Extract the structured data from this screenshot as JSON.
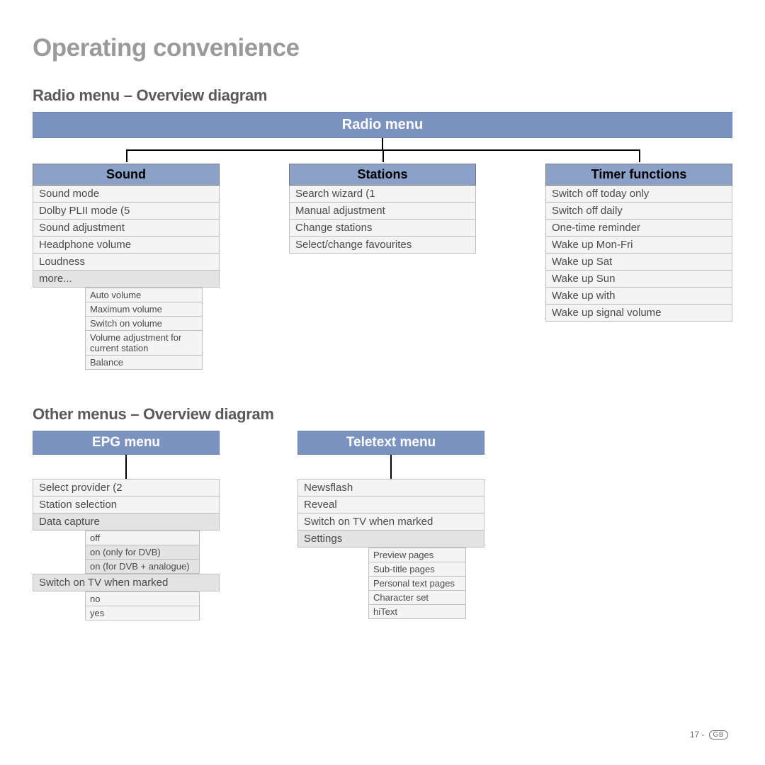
{
  "title": "Operating convenience",
  "section1": "Radio menu – Overview diagram",
  "radio_menu": "Radio menu",
  "sound": {
    "header": "Sound",
    "items": [
      "Sound mode",
      "Dolby PLII mode (5",
      "Sound adjustment",
      "Headphone volume",
      "Loudness"
    ],
    "more": "more...",
    "sub": [
      "Auto volume",
      "Maximum volume",
      "Switch on volume",
      "Volume adjustment for current station",
      "Balance"
    ]
  },
  "stations": {
    "header": "Stations",
    "items": [
      "Search wizard (1",
      "Manual adjustment",
      "Change stations",
      "Select/change favourites"
    ]
  },
  "timer": {
    "header": "Timer functions",
    "items": [
      "Switch off today only",
      "Switch off daily",
      "One-time reminder",
      "Wake up Mon-Fri",
      "Wake up Sat",
      "Wake up Sun",
      "Wake up with",
      "Wake up signal volume"
    ]
  },
  "section2": "Other menus – Overview diagram",
  "epg": {
    "header": "EPG menu",
    "items": [
      "Select provider (2",
      "Station selection"
    ],
    "expand1": "Data capture",
    "sub1": [
      "off",
      "on (only for DVB)",
      "on (for DVB + analogue)"
    ],
    "expand2": "Switch on TV when marked",
    "sub2": [
      "no",
      "yes"
    ]
  },
  "tele": {
    "header": "Teletext menu",
    "items": [
      "Newsflash",
      "Reveal",
      "Switch on TV when marked"
    ],
    "expand": "Settings",
    "sub": [
      "Preview pages",
      "Sub-title pages",
      "Personal text pages",
      "Character set",
      "hiText"
    ]
  },
  "footer": {
    "page": "17 -",
    "badge": "GB"
  }
}
